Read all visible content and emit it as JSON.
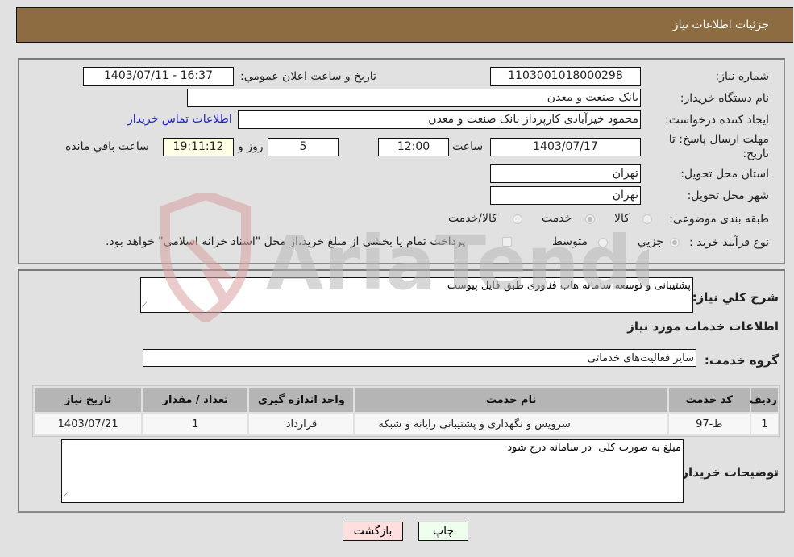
{
  "header": {
    "title": "جزئیات اطلاعات نیاز"
  },
  "form": {
    "need_number": {
      "label": "شماره نیاز:",
      "value": "1103001018000298"
    },
    "announce_datetime": {
      "label": "تاریخ و ساعت اعلان عمومي:",
      "value": "1403/07/11 - 16:37"
    },
    "buyer_org": {
      "label": "نام دستگاه خریدار:",
      "value": "بانک صنعت و معدن"
    },
    "requester": {
      "label": "ایجاد کننده درخواست:",
      "value": "محمود خیرآبادی کارپرداز بانک صنعت و معدن"
    },
    "buyer_contact_link": "اطلاعات تماس خریدار",
    "deadline": {
      "label_line1": "مهلت ارسال پاسخ: تا",
      "label_line2": "تاریخ:",
      "date": "1403/07/17",
      "time_label": "ساعت",
      "time": "12:00",
      "days": "5",
      "days_label": "روز و",
      "remaining": "19:11:12",
      "remaining_label": "ساعت باقي مانده"
    },
    "province": {
      "label": "استان محل تحویل:",
      "value": "تهران"
    },
    "city": {
      "label": "شهر محل تحویل:",
      "value": "تهران"
    },
    "category": {
      "label": "طبقه بندی موضوعی:",
      "options": [
        {
          "label": "کالا",
          "checked": false
        },
        {
          "label": "خدمت",
          "checked": true
        },
        {
          "label": "کالا/خدمت",
          "checked": false
        }
      ]
    },
    "purchase_type": {
      "label": "نوع فرآیند خرید :",
      "options": [
        {
          "label": "جزيي",
          "checked": true
        },
        {
          "label": "متوسط",
          "checked": false
        }
      ],
      "treasury_checkbox_label": "پرداخت تمام یا بخشی از مبلغ خرید،از محل \"اسناد خزانه اسلامی\" خواهد بود."
    }
  },
  "details": {
    "description_label": "شرح کلي نیاز:",
    "description_value": "پشتیبانی و توسعه سامانه هاب فناوری طبق فایل پیوست",
    "services_heading": "اطلاعات خدمات مورد نیاز",
    "service_group_label": "گروه خدمت:",
    "service_group_value": "سایر فعالیت‌های خدماتی",
    "table": {
      "headers": [
        "ردیف",
        "کد خدمت",
        "نام خدمت",
        "واحد اندازه گیری",
        "تعداد / مقدار",
        "تاریخ نیاز"
      ],
      "rows": [
        [
          "1",
          "ط-97",
          "سرویس و نگهداری و پشتیبانی رایانه و شبکه",
          "قرارداد",
          "1",
          "1403/07/21"
        ]
      ]
    },
    "buyer_notes_label": "توضیحات خریدار:",
    "buyer_notes_value": "مبلغ به صورت کلی  در سامانه درج شود"
  },
  "buttons": {
    "print": "چاپ",
    "back": "بازگشت"
  },
  "watermark": {
    "text": "AriaTender.neT"
  },
  "colors": {
    "header_bg": "#8d6c42",
    "back_btn_bg": "#ffdede",
    "print_btn_bg": "#eeffee",
    "link": "#2222cc"
  }
}
